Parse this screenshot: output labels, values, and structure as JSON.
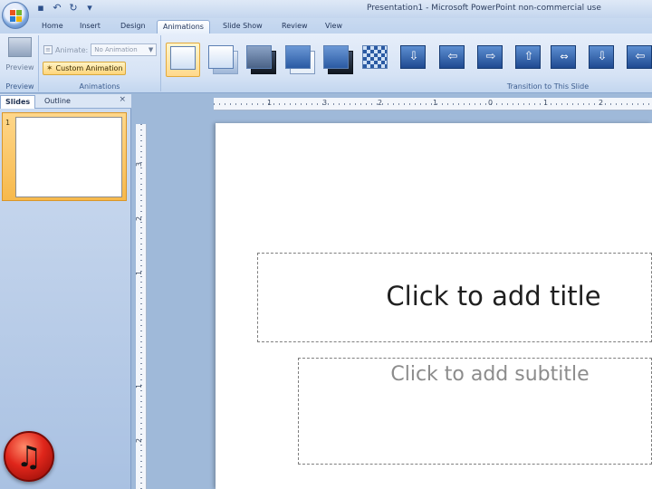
{
  "window": {
    "title": "Presentation1 - Microsoft PowerPoint non-commercial use"
  },
  "tabs": [
    {
      "label": "Home"
    },
    {
      "label": "Insert"
    },
    {
      "label": "Design"
    },
    {
      "label": "Animations",
      "active": true
    },
    {
      "label": "Slide Show"
    },
    {
      "label": "Review"
    },
    {
      "label": "View"
    }
  ],
  "ribbon": {
    "preview": {
      "label": "Preview",
      "group": "Preview"
    },
    "animations_group": {
      "group": "Animations",
      "animate_label": "Animate:",
      "animate_value": "No Animation",
      "custom_animation": "Custom Animation"
    },
    "transitions_group": {
      "group": "Transition to This Slide"
    }
  },
  "left_pane": {
    "tabs": [
      "Slides",
      "Outline"
    ],
    "close": "×",
    "slide_number": "1"
  },
  "ruler": {
    "h_numbers": [
      "1",
      "3",
      "2",
      "1",
      "0",
      "1",
      "2"
    ],
    "v_numbers": [
      "3",
      "2",
      "1",
      "1",
      "2"
    ]
  },
  "slide": {
    "title_placeholder": "Click to add title",
    "subtitle_placeholder": "Click to add subtitle"
  },
  "colors": {
    "accent": "#f7b94c",
    "ribbon": "#d6e3f5",
    "workspace": "#9fb9d9"
  }
}
